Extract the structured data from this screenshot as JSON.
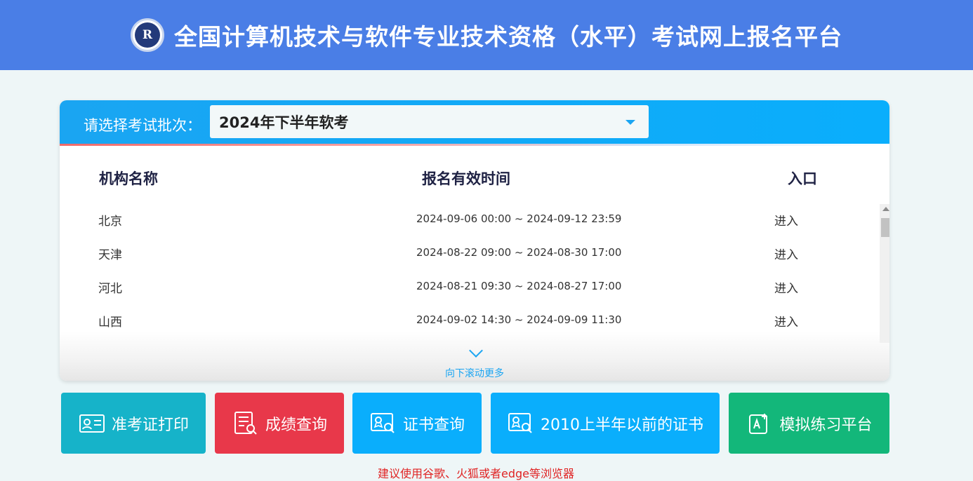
{
  "header": {
    "title": "全国计算机技术与软件专业技术资格（水平）考试网上报名平台",
    "logo_letter": "R"
  },
  "batch": {
    "label": "请选择考试批次：",
    "selected": "2024年下半年软考"
  },
  "table": {
    "columns": [
      "机构名称",
      "报名有效时间",
      "入口"
    ],
    "rows": [
      {
        "org": "北京",
        "time": "2024-09-06 00:00 ~ 2024-09-12 23:59",
        "entry": "进入"
      },
      {
        "org": "天津",
        "time": "2024-08-22 09:00 ~ 2024-08-30 17:00",
        "entry": "进入"
      },
      {
        "org": "河北",
        "time": "2024-08-21 09:30 ~ 2024-08-27 17:00",
        "entry": "进入"
      },
      {
        "org": "山西",
        "time": "2024-09-02 14:30 ~ 2024-09-09 11:30",
        "entry": "进入"
      }
    ],
    "scroll_more": "向下滚动更多"
  },
  "buttons": [
    {
      "label": "准考证打印",
      "icon": "id-card-icon"
    },
    {
      "label": "成绩查询",
      "icon": "score-report-icon"
    },
    {
      "label": "证书查询",
      "icon": "certificate-search-icon"
    },
    {
      "label": "2010上半年以前的证书",
      "icon": "certificate-search-icon"
    },
    {
      "label": "模拟练习平台",
      "icon": "practice-edit-icon"
    }
  ],
  "footer": {
    "hint": "建议使用谷歌、火狐或者edge等浏览器"
  },
  "colors": {
    "header_bg": "#4a7ee6",
    "accent_blue": "#0aaefc",
    "teal": "#16b3c9",
    "red": "#e8384a",
    "green": "#13b77a",
    "hint_red": "#e02424"
  }
}
